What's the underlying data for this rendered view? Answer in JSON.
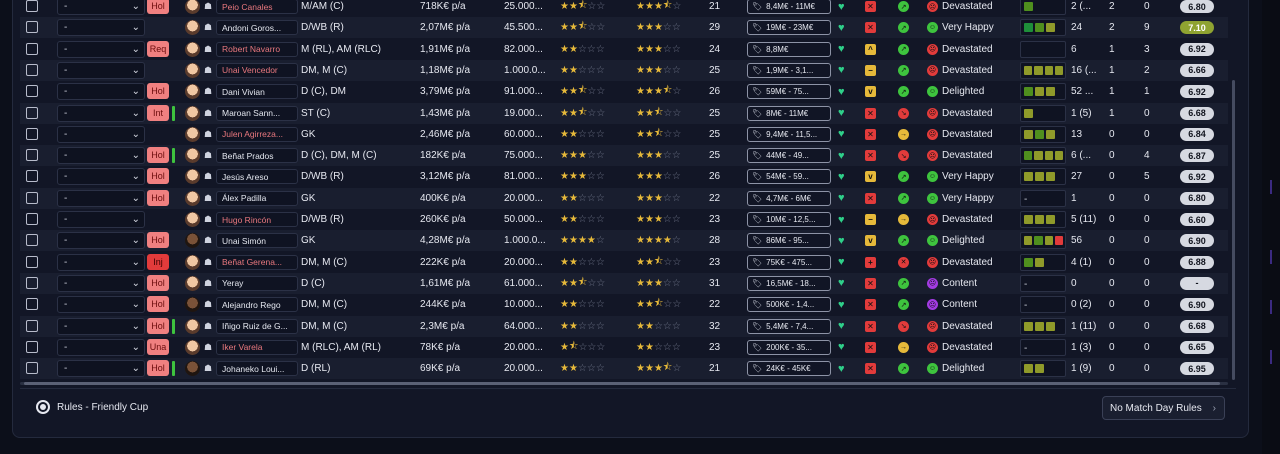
{
  "footer": {
    "rules_label": "Rules - Friendly Cup",
    "match_day_button": "No Match Day Rules"
  },
  "select_placeholder": "-",
  "rows": [
    {
      "status": "Hol",
      "status_color": "#f08080",
      "green_bar": false,
      "name": "Peio Canales",
      "name_red": true,
      "positions": "M/AM (C)",
      "wage": "718K€ p/a",
      "contract": "25.000...",
      "ability": 2.5,
      "potential": 3.5,
      "age": "21",
      "value": "8,4M€ - 11M€",
      "sq_color": "#e23b3b",
      "sq_sym": "✕",
      "circ_color": "#3ec43e",
      "circ_sym": "↗",
      "morale_color": "#e23b3b",
      "morale_sym": "☹",
      "morale": "Devastated",
      "form": [
        "#4f8f1e"
      ],
      "apps": "2 (...",
      "goals": "2",
      "assists": "0",
      "rating": "6.80",
      "rating_hl": false,
      "dark": false
    },
    {
      "status": "",
      "status_color": "",
      "green_bar": false,
      "name": "Andoni Goros...",
      "name_red": false,
      "positions": "D/WB (R)",
      "wage": "2,07M€ p/a",
      "contract": "45.500...",
      "ability": 2.5,
      "potential": 3,
      "age": "29",
      "value": "19M€ - 23M€",
      "sq_color": "#e23b3b",
      "sq_sym": "✕",
      "circ_color": "#3ec43e",
      "circ_sym": "↗",
      "morale_color": "#3ec43e",
      "morale_sym": "☺",
      "morale": "Very Happy",
      "form": [
        "#1e8f3a",
        "#4f8f1e",
        "#8f9a2a"
      ],
      "apps": "24",
      "goals": "2",
      "assists": "9",
      "rating": "7.10",
      "rating_hl": true,
      "dark": false
    },
    {
      "status": "Req",
      "status_color": "#f08080",
      "green_bar": false,
      "name": "Robert Navarro",
      "name_red": true,
      "positions": "M (RL), AM (RLC)",
      "wage": "1,91M€ p/a",
      "contract": "82.000...",
      "ability": 2,
      "potential": 3,
      "age": "24",
      "value": "8,8M€",
      "sq_color": "#e6b93a",
      "sq_sym": "^",
      "circ_color": "#3ec43e",
      "circ_sym": "↗",
      "morale_color": "#e23b3b",
      "morale_sym": "☹",
      "morale": "Devastated",
      "form": [],
      "apps": "6",
      "goals": "1",
      "assists": "3",
      "rating": "6.92",
      "rating_hl": false,
      "dark": false
    },
    {
      "status": "",
      "status_color": "",
      "green_bar": false,
      "name": "Unai Vencedor",
      "name_red": true,
      "positions": "DM, M (C)",
      "wage": "1,18M€ p/a",
      "contract": "1.000.0...",
      "ability": 2,
      "potential": 3,
      "age": "25",
      "value": "1,9M€ - 3,1...",
      "sq_color": "#e6b93a",
      "sq_sym": "−",
      "circ_color": "#3ec43e",
      "circ_sym": "↗",
      "morale_color": "#e23b3b",
      "morale_sym": "☹",
      "morale": "Devastated",
      "form": [
        "#8f9a2a",
        "#8f9a2a",
        "#8f9a2a",
        "#8f9a2a"
      ],
      "apps": "16 (...",
      "goals": "1",
      "assists": "2",
      "rating": "6.66",
      "rating_hl": false,
      "dark": false
    },
    {
      "status": "Hol",
      "status_color": "#f08080",
      "green_bar": false,
      "name": "Dani Vivian",
      "name_red": false,
      "positions": "D (C), DM",
      "wage": "3,79M€ p/a",
      "contract": "91.000...",
      "ability": 2.5,
      "potential": 3.5,
      "age": "26",
      "value": "59M€ - 75...",
      "sq_color": "#e6b93a",
      "sq_sym": "v",
      "circ_color": "#3ec43e",
      "circ_sym": "↗",
      "morale_color": "#3ec43e",
      "morale_sym": "☺",
      "morale": "Delighted",
      "form": [
        "#4f8f1e",
        "#8f9a2a",
        "#8f9a2a"
      ],
      "apps": "52 ...",
      "goals": "1",
      "assists": "1",
      "rating": "6.92",
      "rating_hl": false,
      "dark": false
    },
    {
      "status": "Int",
      "status_color": "#f08080",
      "green_bar": true,
      "name": "Maroan Sann...",
      "name_red": false,
      "positions": "ST (C)",
      "wage": "1,43M€ p/a",
      "contract": "19.000...",
      "ability": 2.5,
      "potential": 2.5,
      "age": "25",
      "value": "8M€ - 11M€",
      "sq_color": "#e23b3b",
      "sq_sym": "✕",
      "circ_color": "#e23b3b",
      "circ_sym": "↘",
      "morale_color": "#e23b3b",
      "morale_sym": "☹",
      "morale": "Devastated",
      "form": [
        "#8f9a2a"
      ],
      "apps": "1 (5)",
      "goals": "1",
      "assists": "0",
      "rating": "6.68",
      "rating_hl": false,
      "dark": false
    },
    {
      "status": "",
      "status_color": "",
      "green_bar": false,
      "name": "Julen Agirreza...",
      "name_red": true,
      "positions": "GK",
      "wage": "2,46M€ p/a",
      "contract": "60.000...",
      "ability": 2,
      "potential": 2.5,
      "age": "25",
      "value": "9,4M€ - 11,5...",
      "sq_color": "#e23b3b",
      "sq_sym": "✕",
      "circ_color": "#e6b93a",
      "circ_sym": "→",
      "morale_color": "#e23b3b",
      "morale_sym": "☹",
      "morale": "Devastated",
      "form": [
        "#8f9a2a",
        "#4f8f1e",
        "#8f9a2a"
      ],
      "apps": "13",
      "goals": "0",
      "assists": "0",
      "rating": "6.84",
      "rating_hl": false,
      "dark": false
    },
    {
      "status": "Hol",
      "status_color": "#f08080",
      "green_bar": true,
      "name": "Beñat Prados",
      "name_red": false,
      "positions": "D (C), DM, M (C)",
      "wage": "182K€ p/a",
      "contract": "75.000...",
      "ability": 3,
      "potential": 3,
      "age": "25",
      "value": "44M€ - 49...",
      "sq_color": "#e23b3b",
      "sq_sym": "✕",
      "circ_color": "#e23b3b",
      "circ_sym": "↘",
      "morale_color": "#e23b3b",
      "morale_sym": "☹",
      "morale": "Devastated",
      "form": [
        "#4f8f1e",
        "#8f9a2a",
        "#8f9a2a",
        "#8f9a2a"
      ],
      "apps": "6 (...",
      "goals": "0",
      "assists": "4",
      "rating": "6.87",
      "rating_hl": false,
      "dark": false
    },
    {
      "status": "Hol",
      "status_color": "#f08080",
      "green_bar": false,
      "name": "Jesús Areso",
      "name_red": false,
      "positions": "D/WB (R)",
      "wage": "3,12M€ p/a",
      "contract": "81.000...",
      "ability": 3,
      "potential": 3,
      "age": "26",
      "value": "54M€ - 59...",
      "sq_color": "#e6b93a",
      "sq_sym": "v",
      "circ_color": "#3ec43e",
      "circ_sym": "↗",
      "morale_color": "#3ec43e",
      "morale_sym": "☺",
      "morale": "Very Happy",
      "form": [
        "#8f9a2a",
        "#8f9a2a",
        "#8f9a2a"
      ],
      "apps": "27",
      "goals": "0",
      "assists": "5",
      "rating": "6.92",
      "rating_hl": false,
      "dark": false
    },
    {
      "status": "Hol",
      "status_color": "#f08080",
      "green_bar": false,
      "name": "Álex Padilla",
      "name_red": false,
      "positions": "GK",
      "wage": "400K€ p/a",
      "contract": "20.000...",
      "ability": 2,
      "potential": 3,
      "age": "22",
      "value": "4,7M€ - 6M€",
      "sq_color": "#e23b3b",
      "sq_sym": "✕",
      "circ_color": "#3ec43e",
      "circ_sym": "↗",
      "morale_color": "#3ec43e",
      "morale_sym": "☺",
      "morale": "Very Happy",
      "form": [
        "-"
      ],
      "apps": "1",
      "goals": "0",
      "assists": "0",
      "rating": "6.80",
      "rating_hl": false,
      "dark": false
    },
    {
      "status": "",
      "status_color": "",
      "green_bar": false,
      "name": "Hugo Rincón",
      "name_red": true,
      "positions": "D/WB (R)",
      "wage": "260K€ p/a",
      "contract": "50.000...",
      "ability": 2,
      "potential": 3,
      "age": "23",
      "value": "10M€ - 12,5...",
      "sq_color": "#e6b93a",
      "sq_sym": "−",
      "circ_color": "#e6b93a",
      "circ_sym": "→",
      "morale_color": "#e23b3b",
      "morale_sym": "☹",
      "morale": "Devastated",
      "form": [
        "#8f9a2a",
        "#8f9a2a",
        "#8f9a2a"
      ],
      "apps": "5 (11)",
      "goals": "0",
      "assists": "0",
      "rating": "6.60",
      "rating_hl": false,
      "dark": false
    },
    {
      "status": "Hol",
      "status_color": "#f08080",
      "green_bar": false,
      "name": "Unai Simón",
      "name_red": false,
      "positions": "GK",
      "wage": "4,28M€ p/a",
      "contract": "1.000.0...",
      "ability": 4,
      "potential": 4,
      "age": "28",
      "value": "86M€ - 95...",
      "sq_color": "#e6b93a",
      "sq_sym": "v",
      "circ_color": "#3ec43e",
      "circ_sym": "↗",
      "morale_color": "#3ec43e",
      "morale_sym": "☺",
      "morale": "Delighted",
      "form": [
        "#8f9a2a",
        "#4f8f1e",
        "#8f9a2a",
        "#e23b3b"
      ],
      "apps": "56",
      "goals": "0",
      "assists": "0",
      "rating": "6.90",
      "rating_hl": false,
      "dark": true
    },
    {
      "status": "Inj",
      "status_color": "#e23b3b",
      "green_bar": false,
      "name": "Beñat Gerena...",
      "name_red": true,
      "positions": "DM, M (C)",
      "wage": "222K€ p/a",
      "contract": "20.000...",
      "ability": 2,
      "potential": 2.5,
      "age": "23",
      "value": "75K€ - 475...",
      "sq_color": "#e23b3b",
      "sq_sym": "+",
      "circ_color": "#e23b3b",
      "circ_sym": "✕",
      "morale_color": "#e23b3b",
      "morale_sym": "☹",
      "morale": "Devastated",
      "form": [
        "#4f8f1e",
        "#8f9a2a"
      ],
      "apps": "4 (1)",
      "goals": "0",
      "assists": "0",
      "rating": "6.88",
      "rating_hl": false,
      "dark": false
    },
    {
      "status": "Hol",
      "status_color": "#f08080",
      "green_bar": false,
      "name": "Yeray",
      "name_red": false,
      "positions": "D (C)",
      "wage": "1,61M€ p/a",
      "contract": "61.000...",
      "ability": 2.5,
      "potential": 3,
      "age": "31",
      "value": "16,5M€ - 18...",
      "sq_color": "#e23b3b",
      "sq_sym": "✕",
      "circ_color": "#3ec43e",
      "circ_sym": "↗",
      "morale_color": "#a23be2",
      "morale_sym": "😐",
      "morale": "Content",
      "form": [
        "-"
      ],
      "apps": "0",
      "goals": "0",
      "assists": "0",
      "rating": "-",
      "rating_hl": false,
      "dark": false
    },
    {
      "status": "Hol",
      "status_color": "#f08080",
      "green_bar": false,
      "name": "Alejandro Rego",
      "name_red": false,
      "positions": "DM, M (C)",
      "wage": "244K€ p/a",
      "contract": "10.000...",
      "ability": 2,
      "potential": 2.5,
      "age": "22",
      "value": "500K€ - 1,4...",
      "sq_color": "#e23b3b",
      "sq_sym": "✕",
      "circ_color": "#3ec43e",
      "circ_sym": "↗",
      "morale_color": "#a23be2",
      "morale_sym": "😐",
      "morale": "Content",
      "form": [
        "-"
      ],
      "apps": "0 (2)",
      "goals": "0",
      "assists": "0",
      "rating": "6.90",
      "rating_hl": false,
      "dark": true
    },
    {
      "status": "Hol",
      "status_color": "#f08080",
      "green_bar": true,
      "name": "Iñigo Ruiz de G...",
      "name_red": false,
      "positions": "DM, M (C)",
      "wage": "2,3M€ p/a",
      "contract": "64.000...",
      "ability": 2,
      "potential": 2,
      "age": "32",
      "value": "5,4M€ - 7,4...",
      "sq_color": "#e23b3b",
      "sq_sym": "✕",
      "circ_color": "#e23b3b",
      "circ_sym": "↘",
      "morale_color": "#e23b3b",
      "morale_sym": "☹",
      "morale": "Devastated",
      "form": [
        "#8f9a2a",
        "#8f9a2a",
        "#8f9a2a"
      ],
      "apps": "1 (11)",
      "goals": "0",
      "assists": "0",
      "rating": "6.68",
      "rating_hl": false,
      "dark": false
    },
    {
      "status": "Una",
      "status_color": "#f08080",
      "green_bar": false,
      "name": "Iker Varela",
      "name_red": true,
      "positions": "M (RLC), AM (RL)",
      "wage": "78K€ p/a",
      "contract": "20.000...",
      "ability": 1.5,
      "potential": 2,
      "age": "23",
      "value": "200K€ - 35...",
      "sq_color": "#e23b3b",
      "sq_sym": "✕",
      "circ_color": "#e6b93a",
      "circ_sym": "→",
      "morale_color": "#e23b3b",
      "morale_sym": "☹",
      "morale": "Devastated",
      "form": [
        "-"
      ],
      "apps": "1 (3)",
      "goals": "0",
      "assists": "0",
      "rating": "6.65",
      "rating_hl": false,
      "dark": false
    },
    {
      "status": "Hol",
      "status_color": "#f08080",
      "green_bar": true,
      "name": "Johaneko Loui...",
      "name_red": false,
      "positions": "D (RL)",
      "wage": "69K€ p/a",
      "contract": "20.000...",
      "ability": 2,
      "potential": 3.5,
      "age": "21",
      "value": "24K€ - 45K€",
      "sq_color": "#e23b3b",
      "sq_sym": "✕",
      "circ_color": "#3ec43e",
      "circ_sym": "↗",
      "morale_color": "#3ec43e",
      "morale_sym": "☺",
      "morale": "Delighted",
      "form": [
        "#8f9a2a",
        "#8f9a2a"
      ],
      "apps": "1 (9)",
      "goals": "0",
      "assists": "0",
      "rating": "6.95",
      "rating_hl": false,
      "dark": true
    }
  ]
}
